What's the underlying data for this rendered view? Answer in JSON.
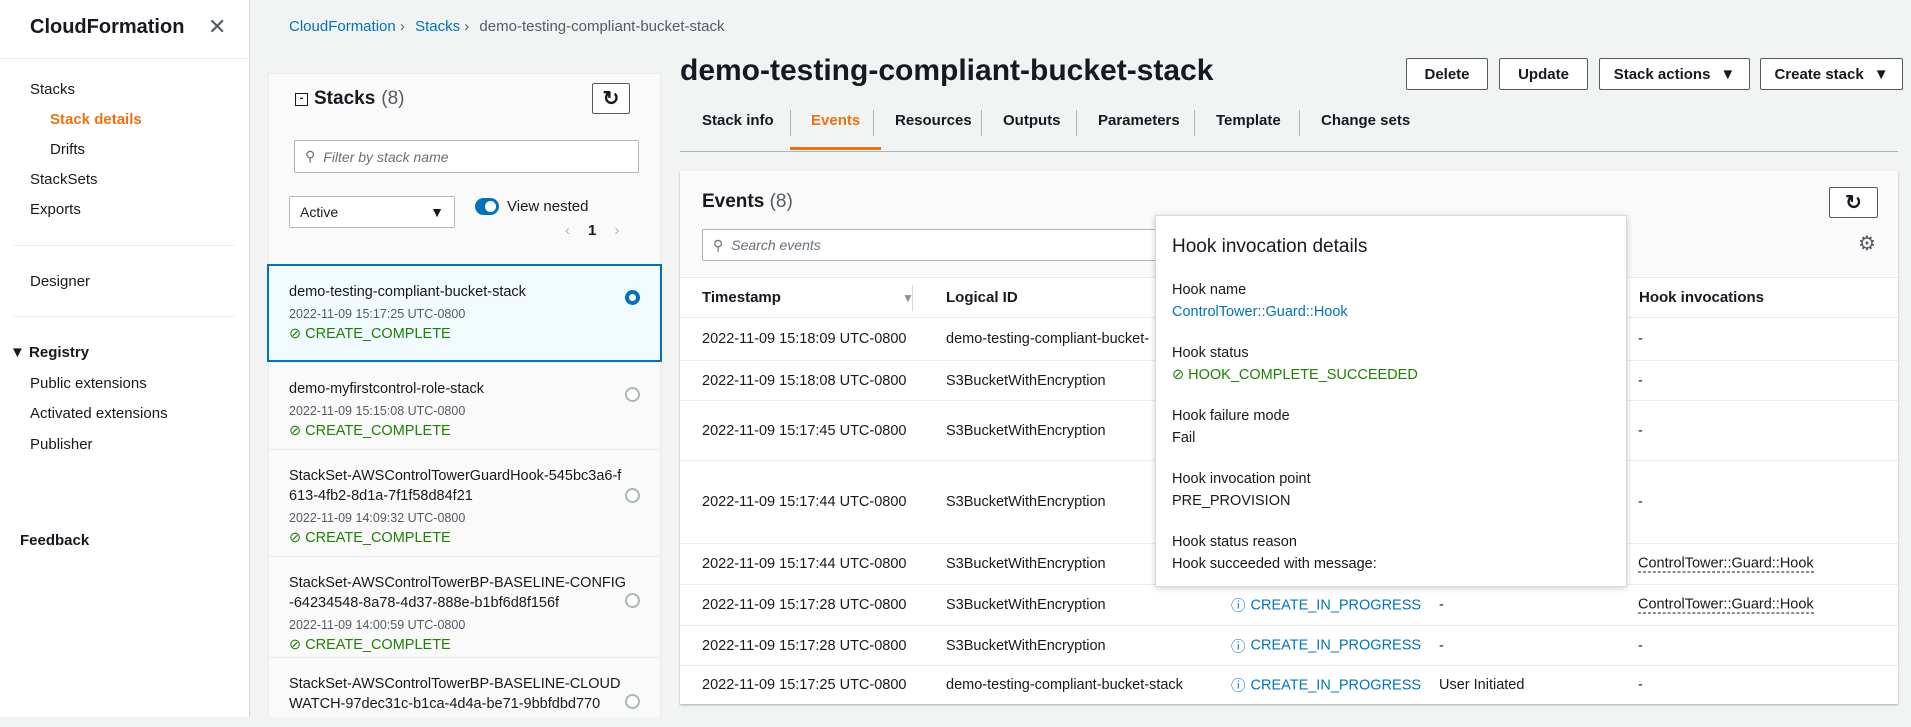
{
  "nav": {
    "title": "CloudFormation",
    "items": [
      "Stacks",
      "Stack details",
      "Drifts",
      "StackSets",
      "Exports",
      "Designer",
      "Registry",
      "Public extensions",
      "Activated extensions",
      "Publisher",
      "Feedback"
    ]
  },
  "breadcrumb": [
    "CloudFormation",
    "Stacks",
    "demo-testing-compliant-bucket-stack"
  ],
  "stacks_panel": {
    "title": "Stacks",
    "count": "(8)",
    "filter_placeholder": "Filter by stack name",
    "status_filter": "Active",
    "view_nested": "View nested",
    "page": "1",
    "items": [
      {
        "name": "demo-testing-compliant-bucket-stack",
        "time": "2022-11-09 15:17:25 UTC-0800",
        "status": "CREATE_COMPLETE"
      },
      {
        "name": "demo-myfirstcontrol-role-stack",
        "time": "2022-11-09 15:15:08 UTC-0800",
        "status": "CREATE_COMPLETE"
      },
      {
        "name": "StackSet-AWSControlTowerGuardHook-545bc3a6-f613-4fb2-8d1a-7f1f58d84f21",
        "time": "2022-11-09 14:09:32 UTC-0800",
        "status": "CREATE_COMPLETE"
      },
      {
        "name": "StackSet-AWSControlTowerBP-BASELINE-CONFIG-64234548-8a78-4d37-888e-b1bf6d8f156f",
        "time": "2022-11-09 14:00:59 UTC-0800",
        "status": "CREATE_COMPLETE"
      },
      {
        "name": "StackSet-AWSControlTowerBP-BASELINE-CLOUDWATCH-97dec31c-b1ca-4d4a-be71-9bbfdbd770",
        "time": "",
        "status": ""
      }
    ]
  },
  "page_title": "demo-testing-compliant-bucket-stack",
  "actions": {
    "delete": "Delete",
    "update": "Update",
    "stack_actions": "Stack actions",
    "create_stack": "Create stack"
  },
  "tabs": [
    "Stack info",
    "Events",
    "Resources",
    "Outputs",
    "Parameters",
    "Template",
    "Change sets"
  ],
  "events": {
    "title": "Events",
    "count": "(8)",
    "search_placeholder": "Search events",
    "columns": [
      "Timestamp",
      "Logical ID",
      "Hook invocations"
    ],
    "rows": [
      {
        "ts": "2022-11-09 15:18:09 UTC-0800",
        "id": "demo-testing-compliant-bucket-",
        "status": "",
        "reason": "",
        "hook": "-"
      },
      {
        "ts": "2022-11-09 15:18:08 UTC-0800",
        "id": "S3BucketWithEncryption",
        "status": "",
        "reason": "",
        "hook": "-"
      },
      {
        "ts": "2022-11-09 15:17:45 UTC-0800",
        "id": "S3BucketWithEncryption",
        "status": "",
        "reason": "",
        "hook": "-"
      },
      {
        "ts": "2022-11-09 15:17:44 UTC-0800",
        "id": "S3BucketWithEncryption",
        "status": "",
        "reason": "",
        "hook": "-"
      },
      {
        "ts": "2022-11-09 15:17:44 UTC-0800",
        "id": "S3BucketWithEncryption",
        "status": "",
        "reason": "",
        "hook": "ControlTower::Guard::Hook"
      },
      {
        "ts": "2022-11-09 15:17:28 UTC-0800",
        "id": "S3BucketWithEncryption",
        "status": "CREATE_IN_PROGRESS",
        "reason": "-",
        "hook": "ControlTower::Guard::Hook"
      },
      {
        "ts": "2022-11-09 15:17:28 UTC-0800",
        "id": "S3BucketWithEncryption",
        "status": "CREATE_IN_PROGRESS",
        "reason": "-",
        "hook": "-"
      },
      {
        "ts": "2022-11-09 15:17:25 UTC-0800",
        "id": "demo-testing-compliant-bucket-stack",
        "status": "CREATE_IN_PROGRESS",
        "reason": "User Initiated",
        "hook": "-"
      }
    ]
  },
  "popover": {
    "title": "Hook invocation details",
    "fields": [
      {
        "k": "Hook name",
        "v": "ControlTower::Guard::Hook"
      },
      {
        "k": "Hook status",
        "v": "HOOK_COMPLETE_SUCCEEDED"
      },
      {
        "k": "Hook failure mode",
        "v": "Fail"
      },
      {
        "k": "Hook invocation point",
        "v": "PRE_PROVISION"
      },
      {
        "k": "Hook status reason",
        "v": "Hook succeeded with message:"
      }
    ]
  },
  "colors": {
    "accent": "#ec7211",
    "link": "#0073bb",
    "success": "#1d8102"
  }
}
